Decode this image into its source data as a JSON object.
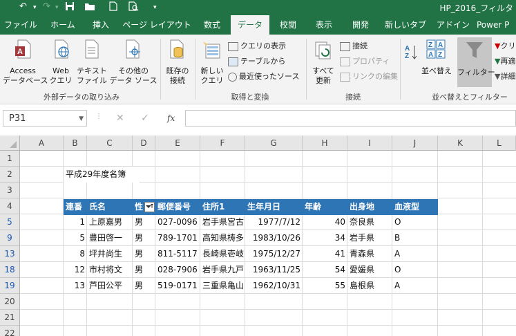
{
  "titlebar": {
    "title": "HP_2016_フィルタ"
  },
  "tabs": [
    "ファイル",
    "ホーム",
    "挿入",
    "ページ レイアウト",
    "数式",
    "データ",
    "校閲",
    "表示",
    "開発",
    "新しいタブ",
    "アドイン",
    "Power P"
  ],
  "active_tab": "データ",
  "ribbon": {
    "access": [
      "Access",
      "データベース"
    ],
    "web": [
      "Web",
      "クエリ"
    ],
    "text": [
      "テキスト",
      "ファイル"
    ],
    "other": [
      "その他の",
      "データ ソース"
    ],
    "existing": [
      "既存の",
      "接続"
    ],
    "group_external": "外部データの取り込み",
    "new_query": [
      "新しい",
      "クエリ"
    ],
    "show_query": "クエリの表示",
    "from_table": "テーブルから",
    "recent_sources": "最近使ったソース",
    "group_transform": "取得と変換",
    "refresh_all": [
      "すべて",
      "更新"
    ],
    "connections": "接続",
    "properties": "プロパティ",
    "edit_links": "リンクの編集",
    "group_connections": "接続",
    "sort": "並べ替え",
    "filter": "フィルター",
    "clear_partial": "クリ",
    "reapply_partial": "再適",
    "advanced_partial": "詳細",
    "group_sortfilter": "並べ替えとフィルター"
  },
  "formula_bar": {
    "name_box": "P31",
    "fx": "fx",
    "cancel": "✕",
    "enter": "✓",
    "formula": ""
  },
  "columns": [
    "A",
    "B",
    "C",
    "D",
    "E",
    "F",
    "G",
    "H",
    "I",
    "J",
    "K",
    "L"
  ],
  "rows": [
    "1",
    "2",
    "3",
    "4",
    "5",
    "9",
    "13",
    "18",
    "19",
    "20",
    "21",
    "22"
  ],
  "sheet": {
    "title": "平成29年度名簿",
    "headers": [
      "連番",
      "氏名",
      "性",
      "郵便番号",
      "住所1",
      "生年月日",
      "年齢",
      "出身地",
      "血液型"
    ],
    "records": [
      [
        "1",
        "上原嘉男",
        "男",
        "027-0096",
        "岩手県宮古",
        "1977/7/12",
        "40",
        "奈良県",
        "O"
      ],
      [
        "5",
        "豊田啓一",
        "男",
        "789-1701",
        "高知県梼多",
        "1983/10/26",
        "34",
        "岩手県",
        "B"
      ],
      [
        "8",
        "坪井尚生",
        "男",
        "811-5117",
        "長崎県壱岐",
        "1975/12/27",
        "41",
        "青森県",
        "A"
      ],
      [
        "12",
        "市村将文",
        "男",
        "028-7906",
        "岩手県九戸",
        "1963/11/25",
        "54",
        "愛媛県",
        "O"
      ],
      [
        "13",
        "芦田公平",
        "男",
        "519-0171",
        "三重県亀山",
        "1962/10/31",
        "55",
        "島根県",
        "A"
      ]
    ]
  },
  "colors": {
    "excel_green": "#217346",
    "table_header": "#2e75b6",
    "filtered_row_number": "#1a56b5"
  }
}
